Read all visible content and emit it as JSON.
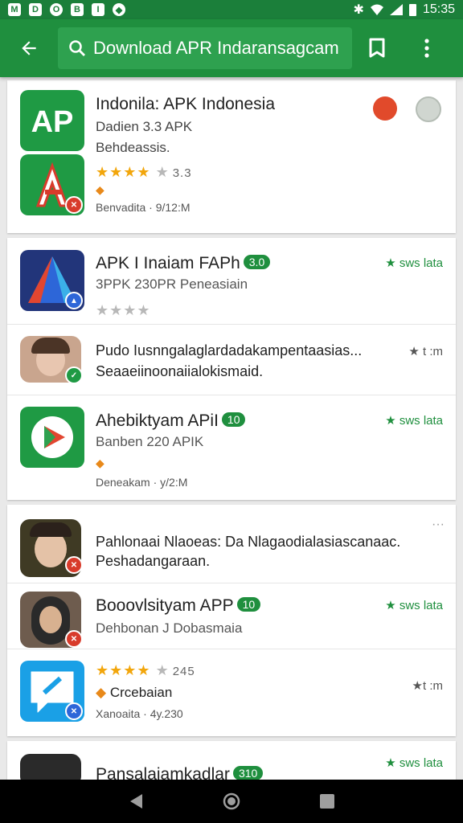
{
  "status_bar": {
    "time": "15:35",
    "icons": [
      "M",
      "D",
      "O",
      "B",
      "I",
      "◆"
    ]
  },
  "app_bar": {
    "search_query": "Download APR Indaransagcam"
  },
  "cards": [
    {
      "rows": [
        {
          "title": "Indonila: APK Indonesia",
          "subtitle": "Dadien 3.3 APK",
          "desc": "Behdeassis.",
          "rating_text": "3.3",
          "meta": "Benvadita · 9/12:M",
          "stars_on": 4
        }
      ]
    },
    {
      "rows": [
        {
          "title": "APK I Inaiam FAPh",
          "pill": "3.0",
          "subtitle": "3PPK 230PR Peneasiain",
          "stars_on": 0,
          "right_badge": "sws lata"
        },
        {
          "desc1": "Pudo Iusnngalaglardadakampentaasias...",
          "desc2": "Seaaeiinoonaiialokismaid.",
          "right_text": "★ t  :m"
        },
        {
          "title": "Ahebiktyam APiI",
          "pill": "10",
          "subtitle": "Banben 220 APIK",
          "meta": "Deneakam · y/2:M",
          "right_badge": "sws lata"
        }
      ]
    },
    {
      "rows": [
        {
          "desc1": "Pahlonaai Nlaoeas: Da Nlagaodialasiascanaac.",
          "desc2": "Peshadangaraan.",
          "more": "···"
        },
        {
          "title": "Booovlsityam APP",
          "pill": "10",
          "subtitle": "Dehbonan J Dobasmaia",
          "right_badge": "sws lata"
        },
        {
          "rating_text": "245",
          "category": "Crcebaian",
          "meta": "Xanoaita · 4y.230",
          "stars_on": 4,
          "right_text": "★t  :m"
        }
      ]
    },
    {
      "rows": [
        {
          "title": "Pansalaiamkadlar",
          "pill": "310",
          "right_badge": "sws lata"
        }
      ]
    }
  ],
  "colors": {
    "brand_green": "#1f8f3e",
    "star": "#f2a60c"
  }
}
